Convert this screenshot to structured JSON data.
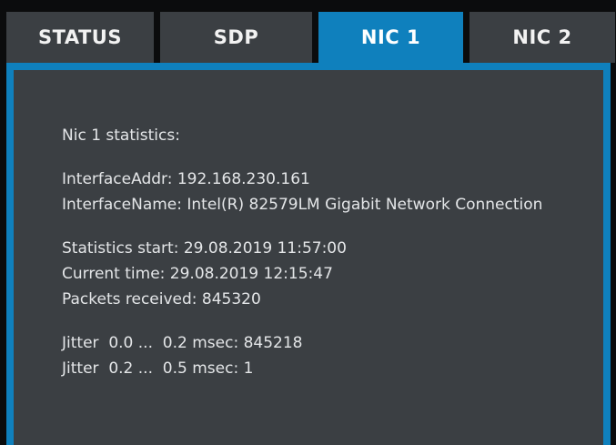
{
  "tabs": [
    {
      "label": "STATUS",
      "active": false
    },
    {
      "label": "SDP",
      "active": false
    },
    {
      "label": "NIC 1",
      "active": true
    },
    {
      "label": "NIC 2",
      "active": false
    }
  ],
  "colors": {
    "accent": "#0f80bd",
    "panel": "#3b3f43",
    "background": "#0b0c0d",
    "text": "#e4e6e8"
  },
  "stats": {
    "heading": "Nic 1 statistics:",
    "interface_addr": "InterfaceAddr: 192.168.230.161",
    "interface_name": "InterfaceName: Intel(R) 82579LM Gigabit Network Connection",
    "statistics_start": "Statistics start: 29.08.2019 11:57:00",
    "current_time": "Current time: 29.08.2019 12:15:47",
    "packets_received": "Packets received: 845320",
    "jitter_1": "Jitter  0.0 ...  0.2 msec: 845218",
    "jitter_2": "Jitter  0.2 ...  0.5 msec: 1"
  }
}
